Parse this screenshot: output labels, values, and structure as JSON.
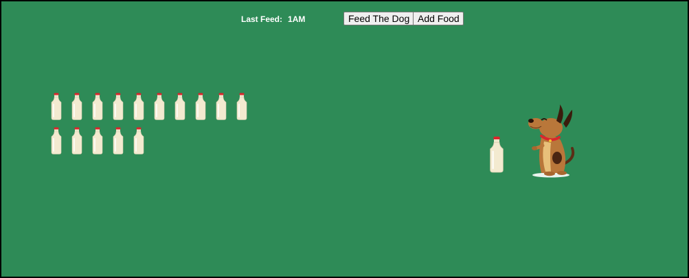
{
  "header": {
    "last_feed_label": "Last Feed:",
    "last_feed_value": "1AM"
  },
  "toolbar": {
    "feed_label": "Feed The Dog",
    "add_food_label": "Add Food"
  },
  "stock": {
    "bottle_count": 15,
    "per_row": 10
  },
  "colors": {
    "background": "#2e8b57",
    "milk": "#f3ead0",
    "cap": "#d9262c",
    "dog_fur": "#b9773a",
    "dog_light": "#e8c07a",
    "collar": "#d9262c"
  },
  "icons": {
    "bottle": "milk-bottle-icon",
    "dog": "dog-sprite"
  }
}
